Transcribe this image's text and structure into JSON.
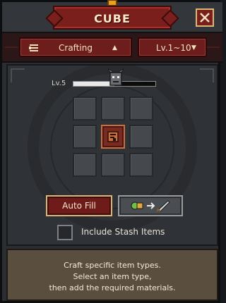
{
  "window": {
    "title": "CUBE",
    "close_icon": "close-x-icon"
  },
  "selectors": {
    "category": {
      "label": "Crafting",
      "icon": "crafting-list-icon",
      "arrow": "▲"
    },
    "level": {
      "label": "Lv.1~10",
      "arrow": "▼"
    }
  },
  "level_slider": {
    "label": "Lv.5",
    "value_fraction": 0.5,
    "knob_icon": "monster-head-icon"
  },
  "crafting_grid": {
    "rows": 3,
    "cols": 3,
    "selected_cell": 4,
    "selected_item_icon": "scroll-icon"
  },
  "buttons": {
    "auto_fill": "Auto Fill",
    "transfer_icon": "items-to-sword-icon"
  },
  "stash": {
    "label": "Include Stash Items",
    "checked": false
  },
  "description": {
    "line1": "Craft specific item types.",
    "line2": "Select an item type,",
    "line3": "then add the required materials."
  },
  "colors": {
    "accent_red": "#7a1f1c",
    "gold": "#d8b777",
    "stone": "#2f3236"
  }
}
